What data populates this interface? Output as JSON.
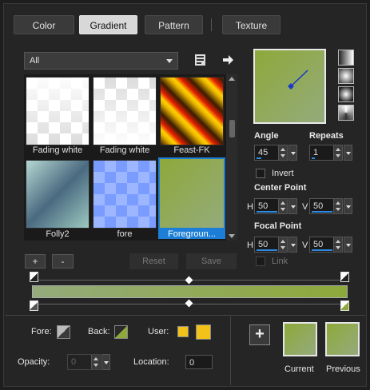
{
  "tabs": [
    {
      "label": "Color"
    },
    {
      "label": "Gradient"
    },
    {
      "label": "Pattern"
    },
    {
      "label": "Texture"
    }
  ],
  "active_tab": "Gradient",
  "category": {
    "value": "All"
  },
  "gallery": {
    "items": [
      {
        "label": "Fading white"
      },
      {
        "label": "Fading white"
      },
      {
        "label": "Feast-FK"
      },
      {
        "label": "Folly2"
      },
      {
        "label": "fore"
      },
      {
        "label": "Foregroun..."
      }
    ],
    "selected_index": 5
  },
  "actions": {
    "add": "+",
    "remove": "-",
    "reset": "Reset",
    "save": "Save"
  },
  "settings": {
    "angle_label": "Angle",
    "angle_value": "45",
    "repeats_label": "Repeats",
    "repeats_value": "1",
    "invert_label": "Invert",
    "center_label": "Center Point",
    "center_h_label": "H",
    "center_h": "50",
    "center_v_label": "V",
    "center_v": "50",
    "focal_label": "Focal Point",
    "focal_h_label": "H",
    "focal_h": "50",
    "focal_v_label": "V",
    "focal_v": "50",
    "link_label": "Link"
  },
  "materials": {
    "fore_label": "Fore:",
    "back_label": "Back:",
    "user_label": "User:",
    "opacity_label": "Opacity:",
    "opacity_value": "0",
    "location_label": "Location:",
    "location_value": "0"
  },
  "result": {
    "current_label": "Current",
    "previous_label": "Previous",
    "add_symbol": "+"
  },
  "colors": {
    "gradient_start": "#94aa7c",
    "gradient_end": "#8ea93a",
    "user_swatch": "#f2c21a",
    "selection": "#1c7ed6"
  }
}
